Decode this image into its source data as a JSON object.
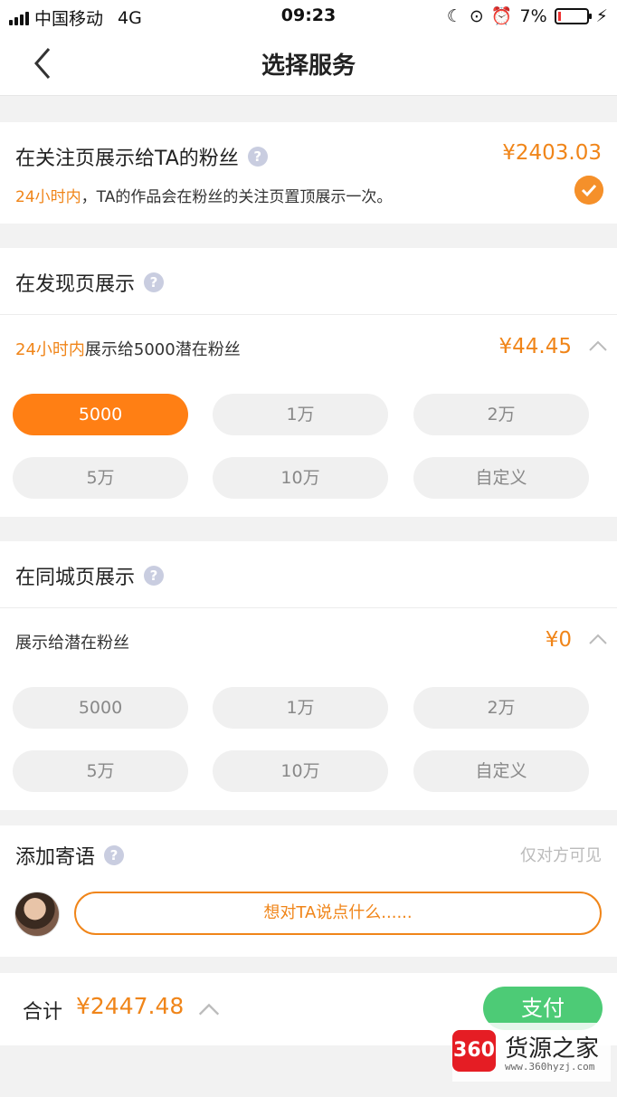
{
  "status_bar": {
    "carrier": "中国移动",
    "network": "4G",
    "time": "09:23",
    "battery": "7%"
  },
  "nav": {
    "title": "选择服务"
  },
  "follow": {
    "title": "在关注页展示给TA的粉丝",
    "price": "¥2403.03",
    "desc_highlight": "24小时内",
    "desc_rest": "，TA的作品会在粉丝的关注页置顶展示一次。"
  },
  "discover": {
    "title": "在发现页展示",
    "detail_highlight": "24小时内",
    "detail_rest": "展示给5000潜在粉丝",
    "price": "¥44.45",
    "options": [
      "5000",
      "1万",
      "2万",
      "5万",
      "10万",
      "自定义"
    ],
    "selected": "5000"
  },
  "local": {
    "title": "在同城页展示",
    "detail": "展示给潜在粉丝",
    "price": "¥0",
    "options": [
      "5000",
      "1万",
      "2万",
      "5万",
      "10万",
      "自定义"
    ]
  },
  "message": {
    "title": "添加寄语",
    "note": "仅对方可见",
    "placeholder": "想对TA说点什么......"
  },
  "footer": {
    "total_label": "合计",
    "total": "¥2447.48",
    "pay_label": "支付"
  },
  "watermark": {
    "badge": "360",
    "name": "货源之家",
    "url": "www.360hyzj.com"
  },
  "colors": {
    "accent": "#f08519",
    "pay": "#4dcb76"
  }
}
